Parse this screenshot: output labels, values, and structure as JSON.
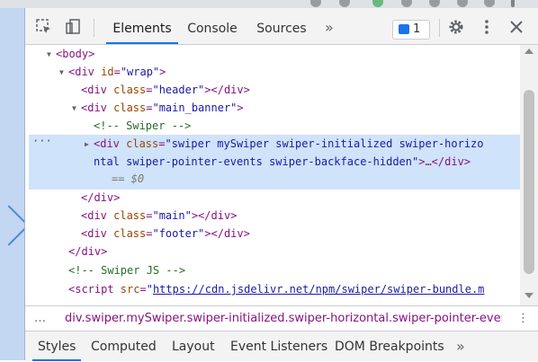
{
  "devtools": {
    "main_tabs": [
      "Elements",
      "Console",
      "Sources"
    ],
    "more_tabs": "»",
    "issues_count": "1"
  },
  "tree": {
    "body_open": "<body>",
    "wrap_tag": "<div ",
    "wrap_attr": "id",
    "wrap_val": "\"wrap\"",
    "header_tag": "<div ",
    "header_attr": "class",
    "header_val": "\"header\"",
    "header_close": "></div>",
    "main_banner_tag": "<div ",
    "main_banner_attr": "class",
    "main_banner_val": "\"main_banner\"",
    "comment_swiper": "<!-- Swiper -->",
    "swiper_tag": "<div ",
    "swiper_attr": "class",
    "swiper_val1": "\"swiper mySwiper swiper-initialized swiper-horizo",
    "swiper_val2": "ntal swiper-pointer-events swiper-backface-hidden\"",
    "swiper_close": ">…</div>",
    "eq_dollar0": "== $0",
    "div_close": "</div>",
    "main_tag": "<div ",
    "main_attr": "class",
    "main_val": "\"main\"",
    "main_close": "></div>",
    "footer_tag": "<div ",
    "footer_attr": "class",
    "footer_val": "\"footer\"",
    "footer_close": "></div>",
    "wrap_close": "</div>",
    "comment_swiper_js": "<!-- Swiper JS -->",
    "script_tag": "<script ",
    "script_attr": "src",
    "script_src": "https://cdn.jsdelivr.net/npm/swiper/swiper-bundle.m"
  },
  "breadcrumb": "div.swiper.mySwiper.swiper-initialized.swiper-horizontal.swiper-pointer-events.s",
  "lower_tabs": [
    "Styles",
    "Computed",
    "Layout",
    "Event Listeners",
    "DOM Breakpoints"
  ],
  "lower_more": "»"
}
